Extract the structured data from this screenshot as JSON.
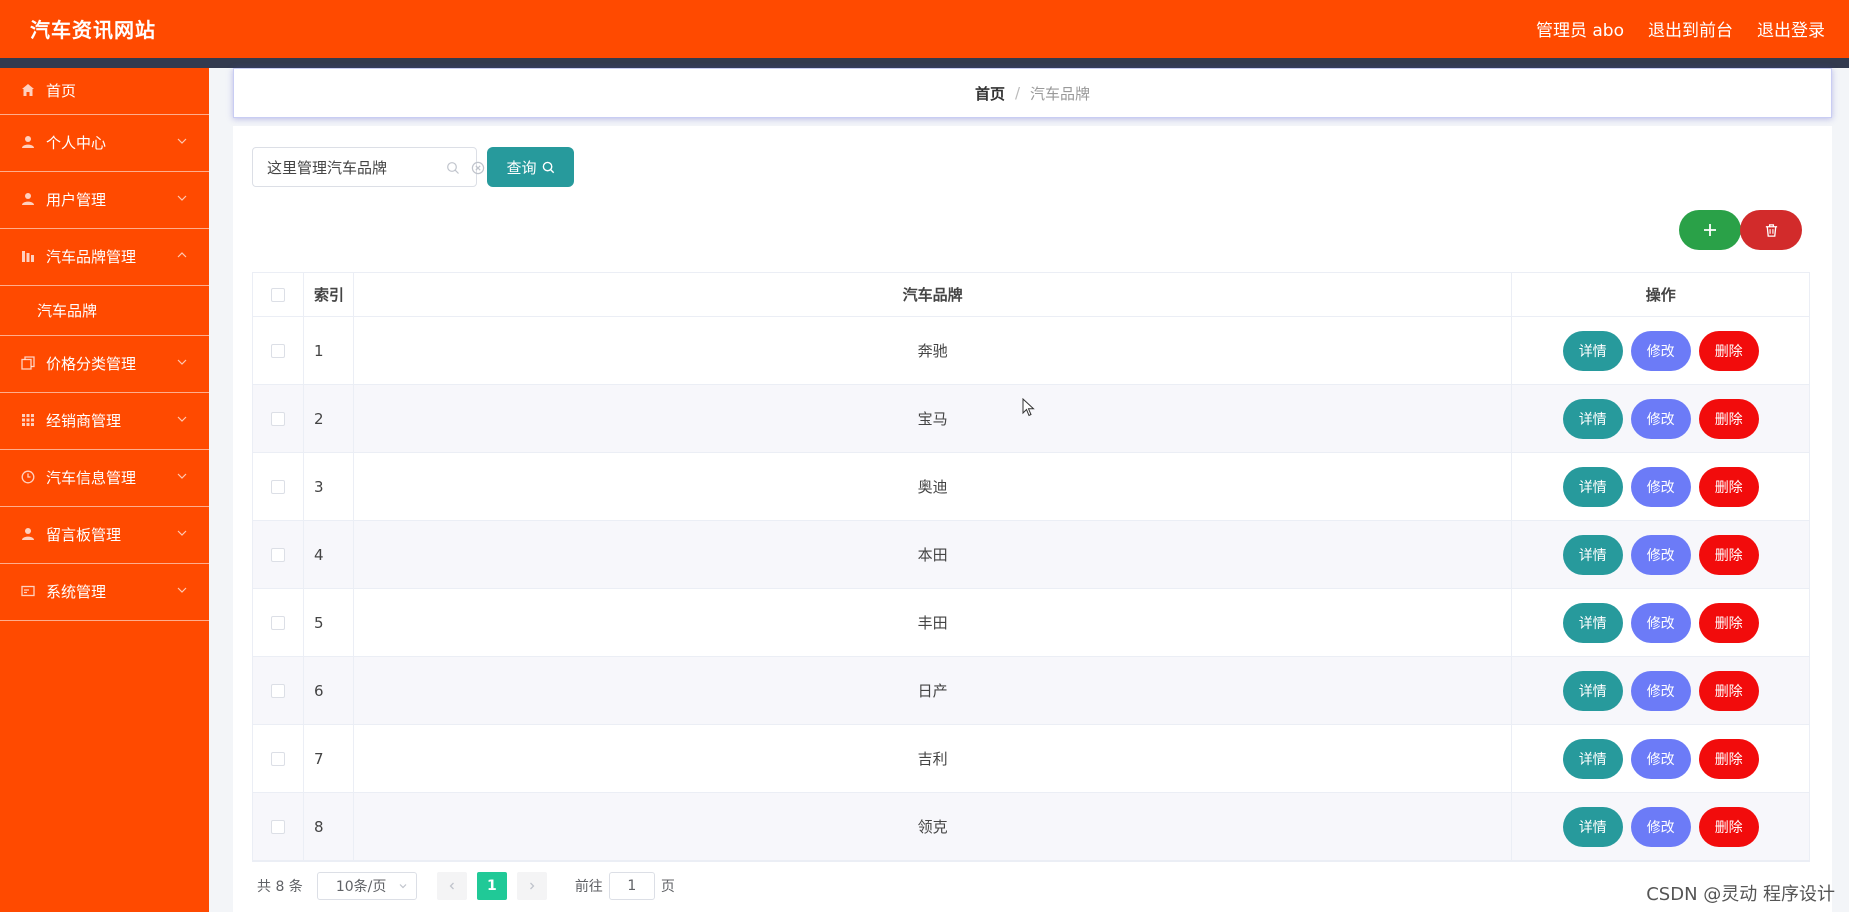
{
  "header": {
    "site_title": "汽车资讯网站",
    "admin_label": "管理员 abo",
    "to_frontend": "退出到前台",
    "logout": "退出登录"
  },
  "sidebar": {
    "items": [
      {
        "label": "首页",
        "icon": "home-icon"
      },
      {
        "label": "个人中心",
        "icon": "user-icon"
      },
      {
        "label": "用户管理",
        "icon": "user-icon"
      },
      {
        "label": "汽车品牌管理",
        "icon": "chart-icon"
      },
      {
        "label": "价格分类管理",
        "icon": "copy-icon"
      },
      {
        "label": "经销商管理",
        "icon": "grid-icon"
      },
      {
        "label": "汽车信息管理",
        "icon": "clock-icon"
      },
      {
        "label": "留言板管理",
        "icon": "user-icon"
      },
      {
        "label": "系统管理",
        "icon": "card-icon"
      }
    ],
    "sub_item": "汽车品牌"
  },
  "breadcrumb": {
    "home": "首页",
    "separator": "/",
    "current": "汽车品牌"
  },
  "search": {
    "value": "这里管理汽车品牌",
    "button_label": "查询"
  },
  "table": {
    "headers": {
      "index": "索引",
      "brand": "汽车品牌",
      "ops": "操作"
    },
    "rows": [
      {
        "index": "1",
        "brand": "奔驰"
      },
      {
        "index": "2",
        "brand": "宝马"
      },
      {
        "index": "3",
        "brand": "奥迪"
      },
      {
        "index": "4",
        "brand": "本田"
      },
      {
        "index": "5",
        "brand": "丰田"
      },
      {
        "index": "6",
        "brand": "日产"
      },
      {
        "index": "7",
        "brand": "吉利"
      },
      {
        "index": "8",
        "brand": "领克"
      }
    ],
    "actions": {
      "detail": "详情",
      "edit": "修改",
      "delete": "删除"
    }
  },
  "pagination": {
    "total": "共 8 条",
    "page_size": "10条/页",
    "current_page": "1",
    "goto_prefix": "前往",
    "goto_value": "1",
    "goto_suffix": "页"
  },
  "watermark": "CSDN @灵动 程序设计",
  "colors": {
    "primary": "#ff4a00",
    "teal": "#279a9c",
    "edit": "#6c7bf7",
    "delete": "#f20c0c",
    "add": "#2aa148"
  }
}
